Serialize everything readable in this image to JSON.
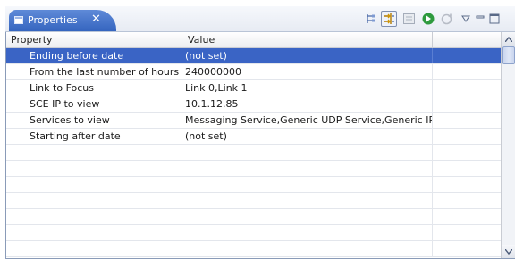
{
  "tab": {
    "title": "Properties",
    "close_glyph": "✕"
  },
  "toolbar": {
    "icons": [
      "show-categories-icon",
      "show-advanced-properties-icon",
      "filter-icon",
      "run-icon",
      "refresh-icon",
      "view-menu-icon",
      "minimize-icon",
      "maximize-icon"
    ]
  },
  "table": {
    "columns": [
      "Property",
      "Value",
      ""
    ],
    "rows": [
      {
        "property": "Ending before date",
        "value": "(not set)",
        "selected": true
      },
      {
        "property": "From the last number of hours",
        "value": "240000000",
        "selected": false
      },
      {
        "property": "Link to Focus",
        "value": "Link 0,Link 1",
        "selected": false
      },
      {
        "property": "SCE IP to view",
        "value": "10.1.12.85",
        "selected": false
      },
      {
        "property": "Services to view",
        "value": "Messaging Service,Generic UDP Service,Generic IP...",
        "selected": false
      },
      {
        "property": "Starting after date",
        "value": "(not set)",
        "selected": false
      }
    ],
    "empty_rows": 7
  },
  "colors": {
    "tab": "#3565bf",
    "selection": "#3a64c5",
    "run_icon": "#2e9a3e"
  }
}
